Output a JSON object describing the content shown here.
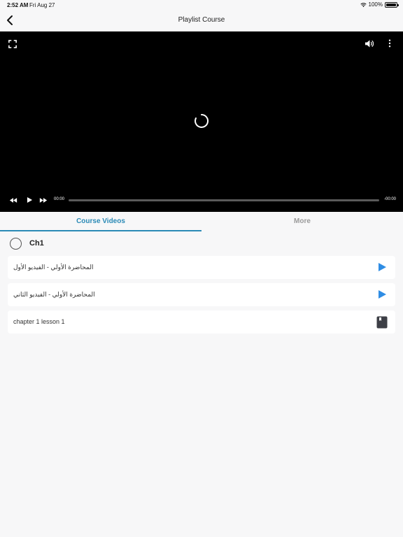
{
  "status_bar": {
    "time": "2:52 AM",
    "date": "Fri Aug 27",
    "battery": "100%"
  },
  "nav": {
    "title": "Playlist Course",
    "back_icon": "chevron-left-icon"
  },
  "player": {
    "current_time": "00:00",
    "remaining_time": "-00:00",
    "progress": 0
  },
  "tabs": [
    {
      "label": "Course Videos",
      "active": true
    },
    {
      "label": "More",
      "active": false
    }
  ],
  "chapter": {
    "title": "Ch1",
    "lessons": [
      {
        "title": "المحاضرة الأولي - الفيديو الأول",
        "icon": "play-icon"
      },
      {
        "title": "المحاضرة الأولي - الفيديو الثاني",
        "icon": "play-icon"
      },
      {
        "title": "chapter 1 lesson 1",
        "icon": "book-icon"
      }
    ]
  },
  "colors": {
    "accent": "#2a8ab6",
    "play": "#2f8de4",
    "book": "#3d3f46"
  }
}
